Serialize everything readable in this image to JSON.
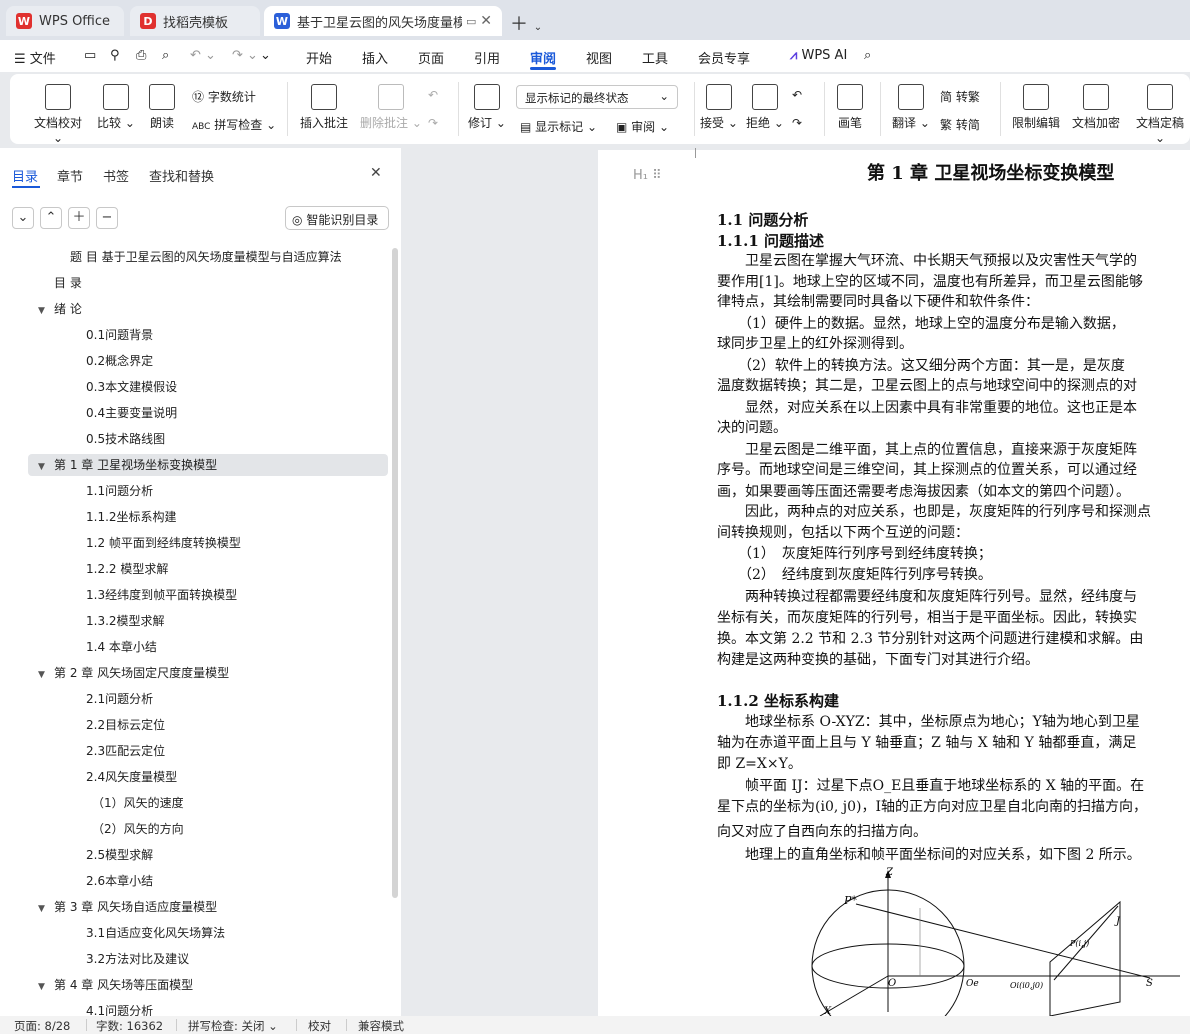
{
  "tabs": [
    {
      "label": "WPS Office"
    },
    {
      "label": "找稻壳模板"
    },
    {
      "label": "基于卫星云图的风矢场度量模型"
    }
  ],
  "menu": {
    "file": "文件",
    "items": [
      "开始",
      "插入",
      "页面",
      "引用",
      "审阅",
      "视图",
      "工具",
      "会员专享"
    ],
    "active": "审阅",
    "wps_ai": "WPS AI"
  },
  "ribbon": {
    "doc_check": "文档校对",
    "compare": "比较",
    "read_aloud": "朗读",
    "word_count": "字数统计",
    "spell_check": "拼写检查",
    "insert_comment": "插入批注",
    "delete_comment": "删除批注",
    "revise": "修订",
    "markup_select": "显示标记的最终状态",
    "show_markup": "显示标记",
    "review": "审阅",
    "accept": "接受",
    "reject": "拒绝",
    "pen": "画笔",
    "translate": "翻译",
    "to_traditional": "转繁",
    "to_simplified": "转简",
    "restrict_edit": "限制编辑",
    "encrypt": "文档加密",
    "finalize": "文档定稿"
  },
  "panel": {
    "tabs": [
      "目录",
      "章节",
      "书签",
      "查找和替换"
    ],
    "smart_toc": "智能识别目录",
    "toc": [
      {
        "text": "题 目 基于卫星云图的风矢场度量模型与自适应算法",
        "level": 0
      },
      {
        "text": "目 录",
        "level": 0
      },
      {
        "text": "绪 论",
        "level": 0,
        "caret": true
      },
      {
        "text": "0.1问题背景",
        "level": 2
      },
      {
        "text": "0.2概念界定",
        "level": 2
      },
      {
        "text": "0.3本文建模假设",
        "level": 2
      },
      {
        "text": "0.4主要变量说明",
        "level": 2
      },
      {
        "text": "0.5技术路线图",
        "level": 2
      },
      {
        "text": "第 1 章 卫星视场坐标变换模型",
        "level": 0,
        "caret": true,
        "selected": true
      },
      {
        "text": "1.1问题分析",
        "level": 2
      },
      {
        "text": "1.1.2坐标系构建",
        "level": 2
      },
      {
        "text": "1.2 帧平面到经纬度转换模型",
        "level": 2
      },
      {
        "text": "1.2.2 模型求解",
        "level": 2
      },
      {
        "text": "1.3经纬度到帧平面转换模型",
        "level": 2
      },
      {
        "text": "1.3.2模型求解",
        "level": 2
      },
      {
        "text": "1.4 本章小结",
        "level": 2
      },
      {
        "text": "第 2 章 风矢场固定尺度度量模型",
        "level": 0,
        "caret": true
      },
      {
        "text": "2.1问题分析",
        "level": 2
      },
      {
        "text": "2.2目标云定位",
        "level": 2
      },
      {
        "text": "2.3匹配云定位",
        "level": 2
      },
      {
        "text": "2.4风矢度量模型",
        "level": 2
      },
      {
        "text": "（1）风矢的速度",
        "level": 3
      },
      {
        "text": "（2）风矢的方向",
        "level": 3
      },
      {
        "text": "2.5模型求解",
        "level": 2
      },
      {
        "text": "2.6本章小结",
        "level": 2
      },
      {
        "text": "第 3 章 风矢场自适应度量模型",
        "level": 0,
        "caret": true
      },
      {
        "text": "3.1自适应变化风矢场算法",
        "level": 2
      },
      {
        "text": "3.2方法对比及建议",
        "level": 2
      },
      {
        "text": "第 4 章 风矢场等压面模型",
        "level": 0,
        "caret": true
      },
      {
        "text": "4.1问题分析",
        "level": 2
      }
    ]
  },
  "doc": {
    "chapter_title": "第 1 章 卫星视场坐标变换模型",
    "lines": [
      {
        "t": "1.1 问题分析",
        "cls": "h2"
      },
      {
        "t": "1.1.1 问题描述",
        "cls": "h2"
      },
      {
        "t": "　　卫星云图在掌握大气环流、中长期天气预报以及灾害性天气学的"
      },
      {
        "t": "要作用[1]。地球上空的区域不同，温度也有所差异，而卫星云图能够"
      },
      {
        "t": "律特点，其绘制需要同时具备以下硬件和软件条件："
      },
      {
        "t": "　　（1）硬件上的数据。显然，地球上空的温度分布是输入数据，"
      },
      {
        "t": "球同步卫星上的红外探测得到。"
      },
      {
        "t": "　　（2）软件上的转换方法。这又细分两个方面：其一是，是灰度"
      },
      {
        "t": "温度数据转换；其二是，卫星云图上的点与地球空间中的探测点的对"
      },
      {
        "t": "　　显然，对应关系在以上因素中具有非常重要的地位。这也正是本"
      },
      {
        "t": "决的问题。"
      },
      {
        "t": "　　卫星云图是二维平面，其上点的位置信息，直接来源于灰度矩阵"
      },
      {
        "t": "序号。而地球空间是三维空间，其上探测点的位置关系，可以通过经"
      },
      {
        "t": "画，如果要画等压面还需要考虑海拔因素（如本文的第四个问题）。"
      },
      {
        "t": "　　因此，两种点的对应关系，也即是，灰度矩阵的行列序号和探测点"
      },
      {
        "t": "间转换规则，包括以下两个互逆的问题："
      },
      {
        "t": "　　（1）　灰度矩阵行列序号到经纬度转换；"
      },
      {
        "t": "　　（2）　经纬度到灰度矩阵行列序号转换。"
      },
      {
        "t": "　　两种转换过程都需要经纬度和灰度矩阵行列号。显然，经纬度与"
      },
      {
        "t": "坐标有关，而灰度矩阵的行列号，相当于是平面坐标。因此，转换实"
      },
      {
        "t": "换。本文第 2.2 节和 2.3 节分别针对这两个问题进行建模和求解。由"
      },
      {
        "t": "构建是这两种变换的基础，下面专门对其进行介绍。"
      },
      {
        "t": "1.1.2 坐标系构建",
        "cls": "h2"
      },
      {
        "t": "　　地球坐标系 O-XYZ：其中，坐标原点为地心；Y轴为地心到卫星"
      },
      {
        "t": "轴为在赤道平面上且与 Y 轴垂直；Z 轴与 X 轴和 Y 轴都垂直，满足"
      },
      {
        "t": "即 Z=X×Y。"
      },
      {
        "t": "　　帧平面 IJ：过星下点O_E且垂直于地球坐标系的 X 轴的平面。在"
      },
      {
        "t": "星下点的坐标为(i0, j0)，I轴的正方向对应卫星自北向南的扫描方向，"
      },
      {
        "t": "向又对应了自西向东的扫描方向。"
      },
      {
        "t": "　　地理上的直角坐标和帧平面坐标间的对应关系，如下图 2 所示。"
      }
    ],
    "figure_labels": {
      "z": "Z",
      "p": "P*",
      "o": "O",
      "oe": "Oe",
      "oij": "Oi(i0,j0)",
      "pij": "P(i,j)",
      "j": "J",
      "s": "S",
      "x": "X"
    }
  },
  "status": {
    "page": "页面: 8/28",
    "words": "字数: 16362",
    "spell": "拼写检查: 关闭",
    "proof": "校对",
    "compat": "兼容模式"
  },
  "colors": {
    "accent": "#1a59d9",
    "wps_red": "#e0312f",
    "doc_blue": "#2b5fd9"
  }
}
